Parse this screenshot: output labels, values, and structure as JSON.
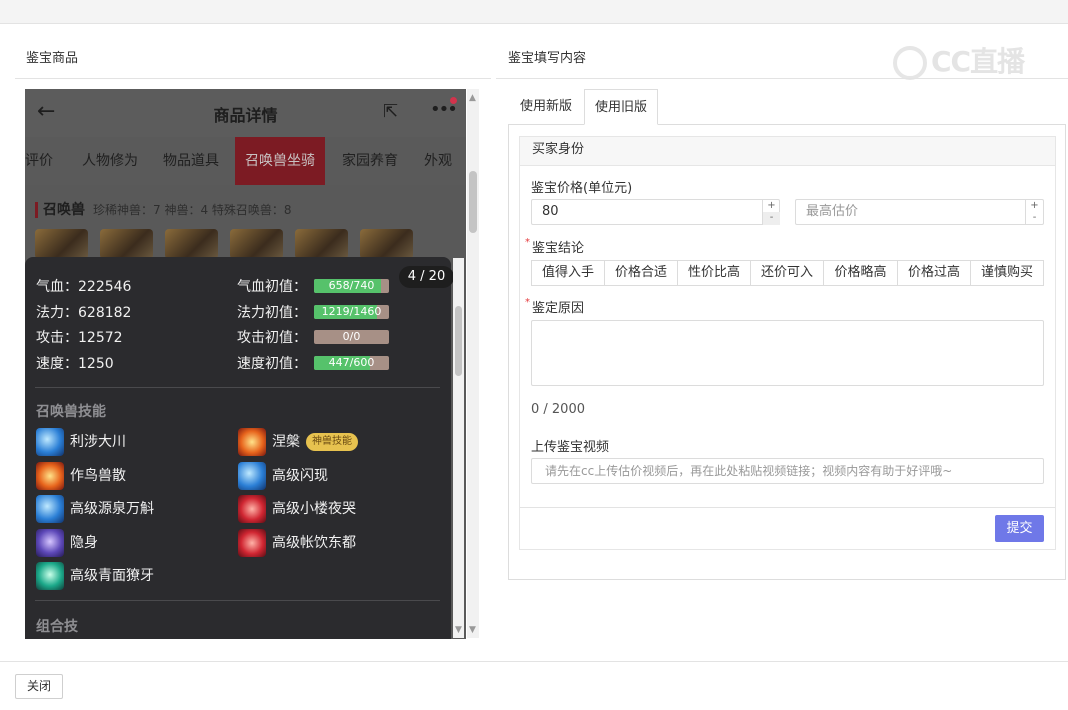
{
  "left": {
    "section_title": "鉴宝商品",
    "phone": {
      "header_title": "商品详情",
      "back_glyph": "←",
      "share_glyph": "⇱",
      "more_glyph": "•••",
      "tabs": [
        "宝评价",
        "人物修为",
        "物品道具",
        "召唤兽坐骑",
        "家园养育",
        "外观"
      ],
      "active_tab": "召唤兽坐骑",
      "summon_title": "召唤兽",
      "summon_counts": "珍稀神兽：7   神兽：4   特殊召唤兽：8"
    },
    "popup": {
      "page_badge": "4 / 20",
      "stats": [
        {
          "label": "气血：",
          "value": "222546"
        },
        {
          "label": "法力：",
          "value": "628182"
        },
        {
          "label": "攻击：",
          "value": "12572"
        },
        {
          "label": "速度：",
          "value": "1250"
        }
      ],
      "initials": [
        {
          "label": "气血初值：",
          "text": "658/740",
          "fraction": 0.889
        },
        {
          "label": "法力初值：",
          "text": "1219/1460",
          "fraction": 0.835
        },
        {
          "label": "攻击初值：",
          "text": "0/0",
          "fraction": 0
        },
        {
          "label": "速度初值：",
          "text": "447/600",
          "fraction": 0.745
        }
      ],
      "skills_heading": "召唤兽技能",
      "skills": [
        {
          "name": "利涉大川",
          "icon": "water-skill-icon"
        },
        {
          "name": "涅槃",
          "icon": "phoenix-skill-icon",
          "tag": "神兽技能"
        },
        {
          "name": "作鸟兽散",
          "icon": "flame-skill-icon"
        },
        {
          "name": "高级闪现",
          "icon": "flash-skill-icon"
        },
        {
          "name": "高级源泉万斛",
          "icon": "spring-skill-icon"
        },
        {
          "name": "高级小楼夜哭",
          "icon": "night-skill-icon"
        },
        {
          "name": "隐身",
          "icon": "stealth-skill-icon"
        },
        {
          "name": "高级帐饮东都",
          "icon": "feast-skill-icon"
        },
        {
          "name": "高级青面獠牙",
          "icon": "fang-skill-icon"
        }
      ],
      "combo_heading": "组合技"
    }
  },
  "right": {
    "section_title": "鉴宝填写内容",
    "watermark": "CC直播",
    "tabs": [
      "使用新版",
      "使用旧版"
    ],
    "active_tab": "使用旧版",
    "card_title": "买家身份",
    "price_label": "鉴宝价格(单位元)",
    "price_value": "80",
    "max_price_placeholder": "最高估价",
    "conclusion_label": "鉴宝结论",
    "conclusion_options": [
      "值得入手",
      "价格合适",
      "性价比高",
      "还价可入",
      "价格略高",
      "价格过高",
      "谨慎购买"
    ],
    "reason_label": "鉴定原因",
    "char_count": "0 / 2000",
    "video_label": "上传鉴宝视频",
    "video_placeholder": "请先在cc上传估价视频后，再在此处粘贴视频链接；视频内容有助于好评哦~",
    "submit_label": "提交"
  },
  "footer": {
    "close_label": "关闭"
  }
}
